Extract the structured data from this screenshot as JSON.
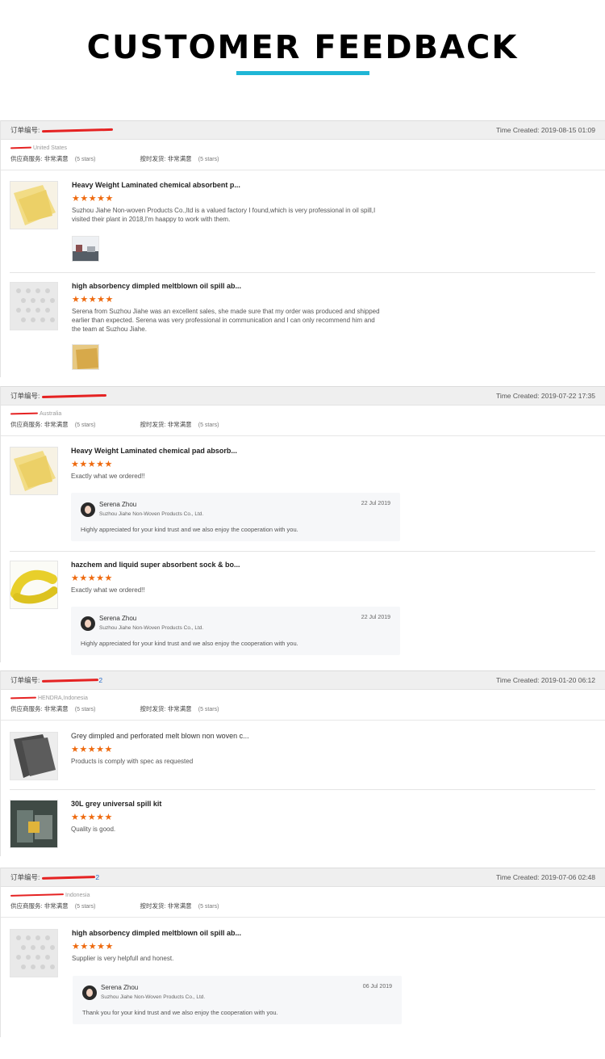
{
  "page": {
    "title": "CUSTOMER FEEDBACK"
  },
  "labels": {
    "order_no": "订单编号:",
    "time_created": "Time Created:",
    "supplier_service": "供应商服务:",
    "on_time_delivery": "按时发货:",
    "very_satisfied": "非常满意",
    "five_stars": "(5 stars)",
    "stars": "★★★★★"
  },
  "orders": [
    {
      "time": "2019-08-15 01:09",
      "country": "United States",
      "items": [
        {
          "name": "Heavy Weight Laminated chemical absorbent p...",
          "review": "Suzhou Jiahe Non-woven Products Co.,ltd is a valued factory I found,which is very professional in oil spill,I visited their plant in 2018,I'm haappy to work with them."
        },
        {
          "name": "high absorbency dimpled meltblown oil spill ab...",
          "review": "Serena from Suzhou Jiahe was an excellent sales, she made sure that my order was produced and shipped earlier than expected. Serena was very professional in communication and I can only recommend him and the team at Suzhou Jiahe."
        }
      ]
    },
    {
      "time": "2019-07-22 17:35",
      "country": "Australia",
      "items": [
        {
          "name": "Heavy Weight Laminated chemical pad absorb...",
          "review": "Exactly what we ordered!!",
          "reply": {
            "name": "Serena Zhou",
            "company": "Suzhou Jiahe Non-Woven Products Co., Ltd.",
            "date": "22 Jul 2019",
            "text": "Highly appreciated for your kind trust and we also enjoy the cooperation with you."
          }
        },
        {
          "name": "hazchem and liquid super absorbent sock & bo...",
          "review": "Exactly what we ordered!!",
          "reply": {
            "name": "Serena Zhou",
            "company": "Suzhou Jiahe Non-Woven Products Co., Ltd.",
            "date": "22 Jul 2019",
            "text": "Highly appreciated for your kind trust and we also enjoy the cooperation with you."
          }
        }
      ]
    },
    {
      "time": "2019-01-20 06:12",
      "country": "HENDRA,Indonesia",
      "order_suffix": "2",
      "items": [
        {
          "name": "Grey dimpled and perforated melt blown non woven c...",
          "review": "Products is comply with spec as requested"
        },
        {
          "name": "30L grey universal spill kit",
          "review": "Quality is good."
        }
      ]
    },
    {
      "time": "2019-07-06 02:48",
      "country": "Indonesia",
      "order_suffix": "2",
      "items": [
        {
          "name": "high absorbency dimpled meltblown oil spill ab...",
          "review": "Supplier is very helpfull and honest.",
          "reply": {
            "name": "Serena Zhou",
            "company": "Suzhou Jiahe Non-Woven Products Co., Ltd.",
            "date": "06 Jul 2019",
            "text": "Thank you for your kind trust and we also enjoy the cooperation with you."
          }
        }
      ]
    }
  ],
  "colors": {
    "accent": "#1fb6d6",
    "star": "#ee6a0f",
    "redact": "#e52222"
  }
}
